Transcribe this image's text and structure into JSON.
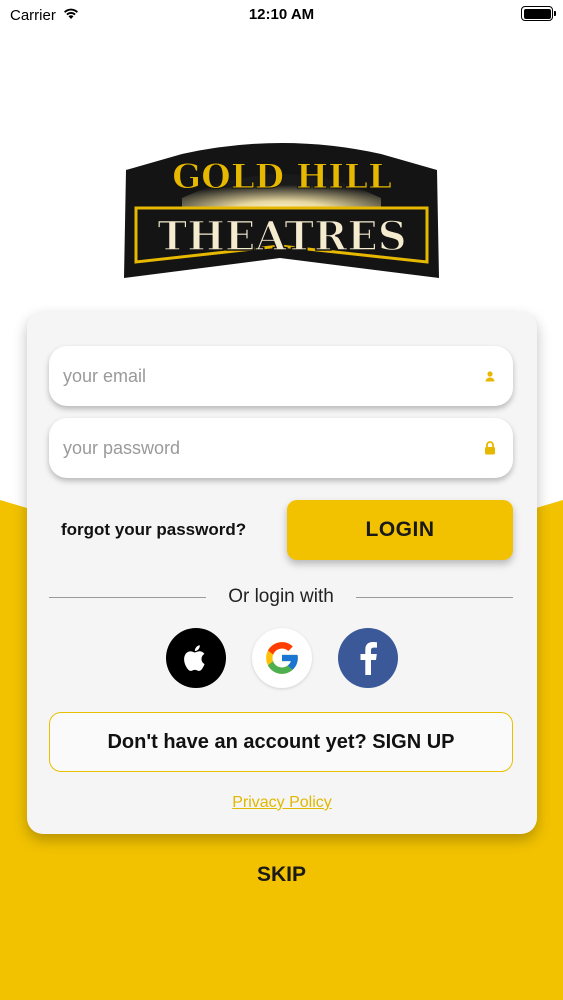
{
  "status_bar": {
    "carrier": "Carrier",
    "time": "12:10 AM",
    "battery_level": 1.0
  },
  "logo": {
    "line1": "GOLD HILL",
    "line2": "THEATRES"
  },
  "login_form": {
    "email": {
      "placeholder": "your email",
      "value": "",
      "icon": "person-icon"
    },
    "password": {
      "placeholder": "your password",
      "value": "",
      "icon": "lock-icon"
    },
    "forgot_label": "forgot your password?",
    "login_label": "LOGIN",
    "divider_label": "Or login with",
    "social_providers": [
      {
        "name": "apple",
        "icon": "apple-icon"
      },
      {
        "name": "google",
        "icon": "google-icon"
      },
      {
        "name": "facebook",
        "icon": "facebook-icon"
      }
    ],
    "signup_label": "Don't have an account yet? SIGN UP",
    "privacy_label": "Privacy Policy"
  },
  "skip_label": "SKIP",
  "colors": {
    "accent": "#f2c200",
    "facebook": "#3b5998",
    "privacy_link": "#e0b800"
  }
}
